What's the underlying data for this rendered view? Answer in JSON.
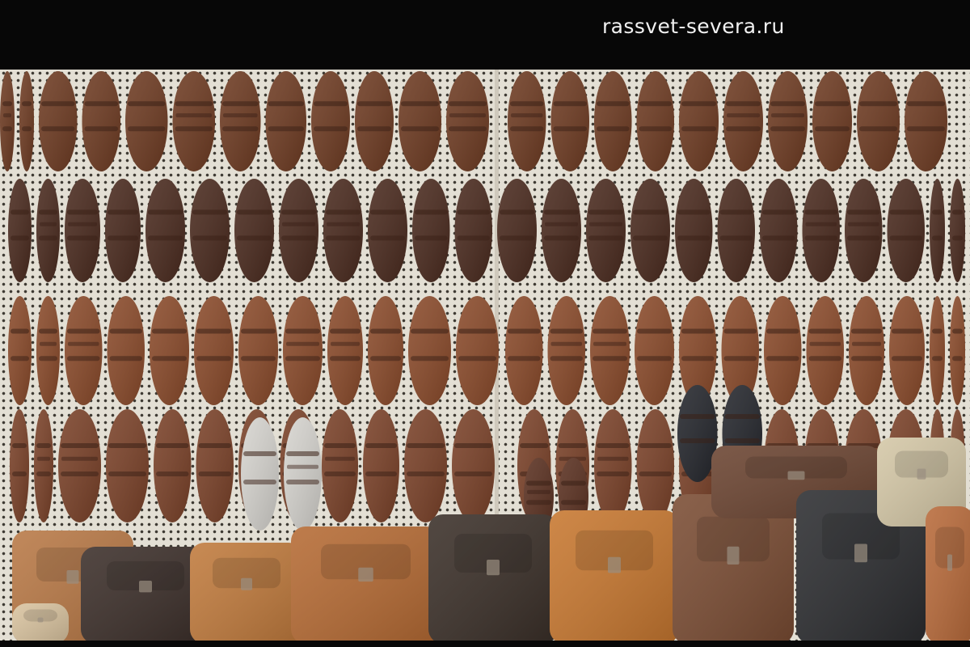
{
  "header": {
    "site_title": "rassvet-severa.ru"
  },
  "photo": {
    "subject": "leather sandals on pegboard with leather bags"
  },
  "colors": {
    "header_bg": "#070707",
    "pegboard": "#e3dfd4",
    "leather_tan": "#b56a33",
    "leather_brown": "#6e3b22",
    "leather_dark": "#2a2624"
  }
}
